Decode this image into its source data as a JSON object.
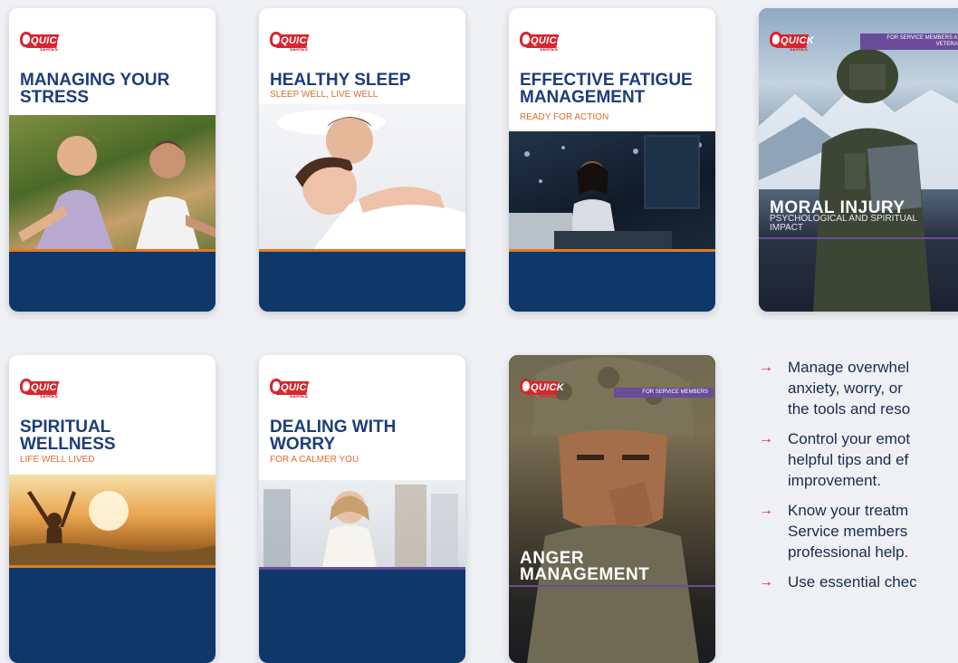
{
  "brand": {
    "logo_text": "QUICK",
    "logo_sub": "SERIES"
  },
  "cards": [
    {
      "title": "MANAGING YOUR STRESS",
      "subtitle": "",
      "photo": "woman-and-man-stretching-photo"
    },
    {
      "title": "HEALTHY SLEEP",
      "subtitle": "SLEEP WELL, LIVE WELL",
      "photo": "couple-sleeping-photo"
    },
    {
      "title": "EFFECTIVE FATIGUE MANAGEMENT",
      "subtitle": "READY FOR ACTION",
      "photo": "woman-at-laptop-at-night-photo"
    },
    {
      "title": "MORAL INJURY",
      "subtitle": "PSYCHOLOGICAL AND SPIRITUAL IMPACT",
      "tag": "FOR SERVICE MEMBERS AND VETERANS",
      "photo": "soldier-in-mountains-photo"
    },
    {
      "title": "SPIRITUAL WELLNESS",
      "subtitle": "LIFE WELL LIVED",
      "photo": "woman-at-sunrise-photo"
    },
    {
      "title": "DEALING WITH WORRY",
      "subtitle": "FOR A CALMER YOU",
      "photo": "woman-in-crowd-photo"
    },
    {
      "title": "ANGER MANAGEMENT",
      "subtitle": "",
      "tag": "FOR SERVICE MEMBERS",
      "photo": "soldier-portrait-photo"
    }
  ],
  "bullets": [
    {
      "lines": [
        "Manage overwhel",
        "anxiety, worry, or",
        "the tools and reso"
      ]
    },
    {
      "lines": [
        "Control your emot",
        "helpful tips and ef",
        "improvement."
      ]
    },
    {
      "lines": [
        "Know your treatm",
        "Service members",
        "professional help."
      ]
    },
    {
      "lines": [
        "Use essential chec"
      ]
    }
  ],
  "colors": {
    "navy": "#0f3769",
    "title_blue": "#1c3d7a",
    "accent_orange": "#e07a2a",
    "brand_red": "#d8262e",
    "purple_tag": "#6a4c9a"
  }
}
